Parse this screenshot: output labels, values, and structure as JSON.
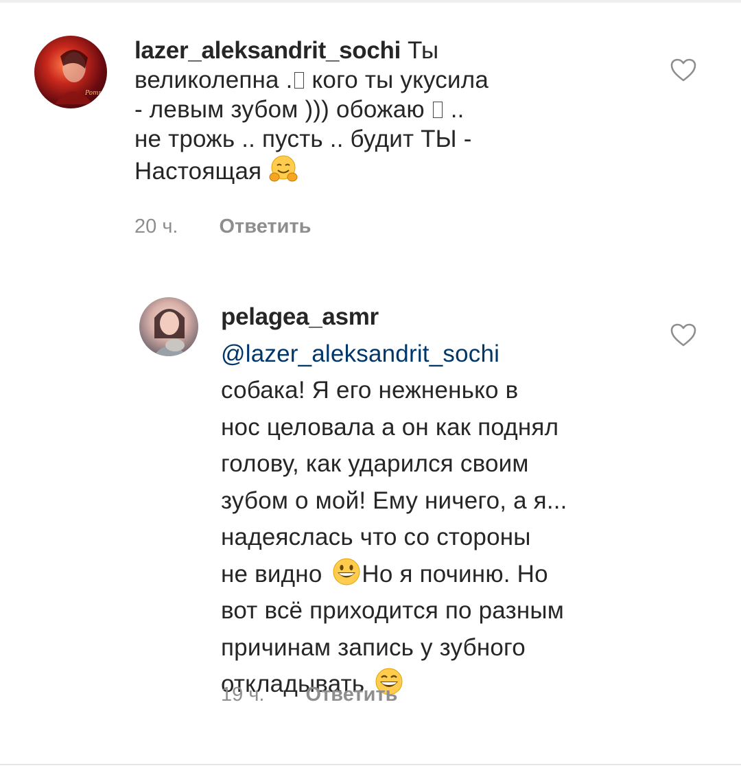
{
  "comments": [
    {
      "username": "lazer_aleksandrit_sochi",
      "lines": [
        "Ты",
        "великолепна .",
        "кого ты укусила",
        "- левым зубом ))) обожаю",
        "..",
        "не трожь .. пусть .. будит ТЫ -",
        "Настоящая"
      ],
      "time": "20 ч.",
      "reply_label": "Ответить",
      "avatar_icon": "avatar-red-portrait",
      "like_icon": "heart-outline-icon",
      "emoji_icon": "hugging-face-emoji"
    },
    {
      "username": "pelagea_asmr",
      "mention": "@lazer_aleksandrit_sochi",
      "lines": [
        "собака! Я его нежненько в",
        "нос целовала а он как поднял",
        "голову, как ударился своим",
        "зубом о мой! Ему ничего, а я...",
        "надеяслась что со стороны",
        "не видно",
        "Но я починю. Но",
        "вот всё приходится по разным",
        "причинам запись у зубного",
        "откладывать"
      ],
      "time": "19 ч.",
      "reply_label": "Ответить",
      "avatar_icon": "avatar-girl-with-cat",
      "like_icon": "heart-outline-icon",
      "emoji_icons": [
        "grinning-face-emoji",
        "smiling-face-emoji"
      ]
    }
  ],
  "colors": {
    "text": "#262626",
    "meta": "#8e8e8e",
    "mention": "#00376b"
  }
}
